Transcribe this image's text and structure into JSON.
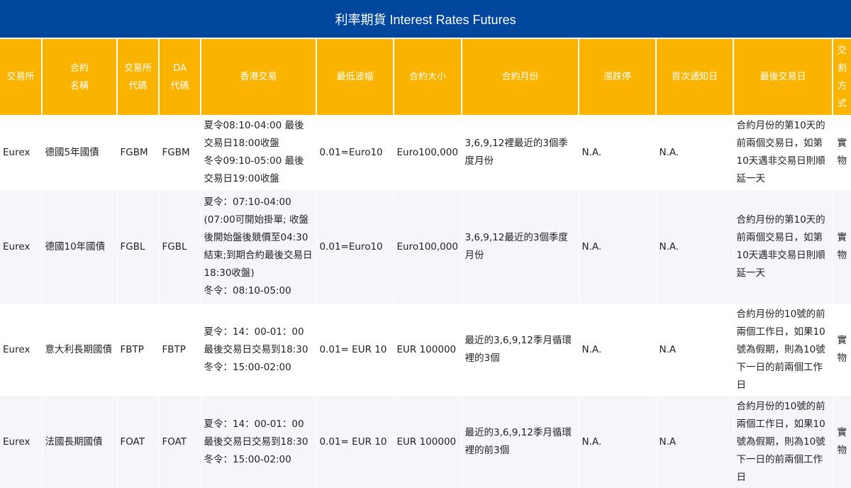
{
  "title": "利率期貨 Interest Rates Futures",
  "headers": {
    "exchange": "交易所",
    "contract_name": "合約\n名稱",
    "exchange_code": "交易所\n代碼",
    "da_code": "DA\n代碼",
    "hk_trading": "香港交易",
    "min_tick": "最低波幅",
    "contract_size": "合約大小",
    "contract_months": "合約月份",
    "limit": "漲跌停",
    "first_notice": "首次通知日",
    "last_trading": "最後交易日",
    "settlement": "交\n割\n方\n式"
  },
  "rows": [
    {
      "exchange": "Eurex",
      "name": "德國5年國債",
      "exchange_code": "FGBM",
      "da_code": "FGBM",
      "hk_trading": "夏令08:10-04:00 最後交易日18:00收盤\n冬令09:10-05:00 最後交易日19:00收盤",
      "min_tick": "0.01=Euro10",
      "size": "Euro100,000",
      "months": "3,6,9,12裡最近的3個季度月份",
      "limit": "N.A.",
      "first_notice": "N.A.",
      "last_trading": "合約月份的第10天的前兩個交易日，如第10天遇非交易日則順延一天",
      "settlement": "實物"
    },
    {
      "exchange": "Eurex",
      "name": "德國10年國債",
      "exchange_code": "FGBL",
      "da_code": "FGBL",
      "hk_trading": "夏令：07:10-04:00\n(07:00可開始掛單; 收盤後開始盤後競價至04:30結束;到期合約最後交易日18:30收盤)\n冬令：08:10-05:00",
      "min_tick": "0.01=Euro10",
      "size": "Euro100,000",
      "months": "3,6,9,12最近的3個季度月份",
      "limit": "N.A.",
      "first_notice": "N.A.",
      "last_trading": "合約月份的第10天的前兩個交易日，如第10天遇非交易日則順延一天",
      "settlement": "實物"
    },
    {
      "exchange": "Eurex",
      "name": "意大利長期國債",
      "exchange_code": "FBTP",
      "da_code": "FBTP",
      "hk_trading": "夏令：14：00-01：00\n最後交易日交易到18:30\n冬令：15:00-02:00",
      "min_tick": "0.01= EUR 10",
      "size": "EUR 100000",
      "months": "最近的3,6,9,12季月循環裡的3個",
      "limit": "N.A.",
      "first_notice": "N.A",
      "last_trading": "合約月份的10號的前兩個工作日，如果10號為假期，則為10號下一日的前兩個工作日",
      "settlement": "實物"
    },
    {
      "exchange": "Eurex",
      "name": "法國長期國債",
      "exchange_code": "FOAT",
      "da_code": "FOAT",
      "hk_trading": "夏令：14：00-01：00\n最後交易日交易到18:30\n冬令：15:00-02:00",
      "min_tick": "0.01= EUR 10",
      "size": "EUR 100000",
      "months": "最近的3,6,9,12季月循環裡的前3個",
      "limit": "N.A.",
      "first_notice": "N.A",
      "last_trading": "合約月份的10號的前兩個工作日，如果10號為假期，則為10號下一日的前兩個工作日",
      "settlement": "實物"
    }
  ]
}
